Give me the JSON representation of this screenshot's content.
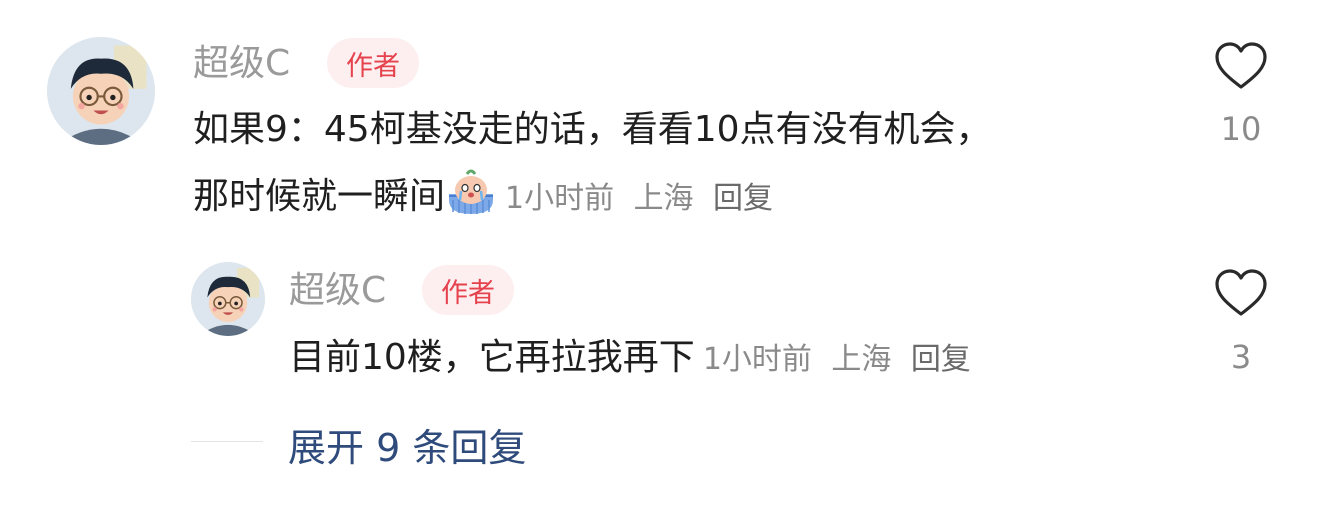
{
  "comment": {
    "author": "超级C",
    "author_badge": "作者",
    "text_line1": "如果9：45柯基没走的话，看看10点有没有机会，",
    "text_line2": "那时候就一瞬间",
    "emoji": "crying-emoji",
    "time": "1小时前",
    "location": "上海",
    "reply_label": "回复",
    "likes": "10"
  },
  "reply": {
    "author": "超级C",
    "author_badge": "作者",
    "text": "目前10楼，它再拉我再下",
    "time": "1小时前",
    "location": "上海",
    "reply_label": "回复",
    "likes": "3"
  },
  "expand_label": "展开 9 条回复",
  "colors": {
    "badge_bg": "#fdeff0",
    "badge_text": "#e5424d",
    "name_text": "#9a9a9a",
    "expand_text": "#2f4b7c"
  },
  "icons": {
    "like": "heart-outline-icon",
    "avatar": "cartoon-boy-avatar"
  }
}
